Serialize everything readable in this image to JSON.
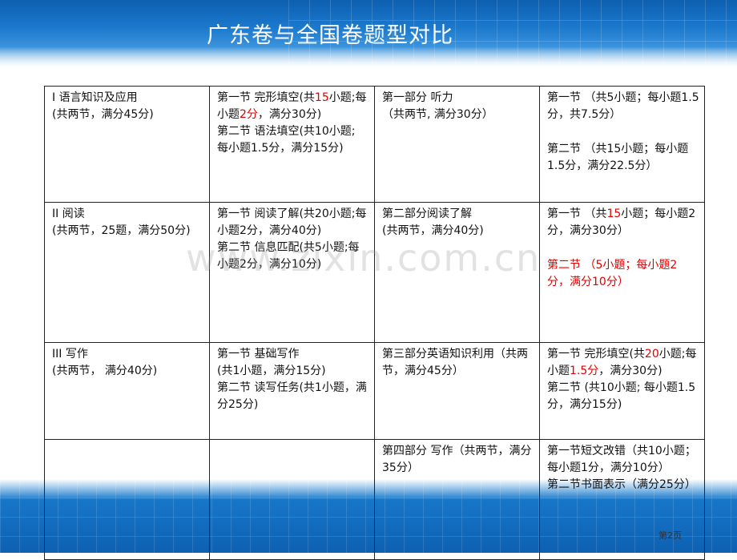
{
  "title": "广东卷与全国卷题型对比",
  "watermark": "www.zixin.com.cn",
  "page_number": "第2页",
  "colors": {
    "accent_red": "#e00000",
    "header_blue": "#1a78cc"
  },
  "rows": [
    {
      "c1": {
        "l1": "I 语言知识及应用",
        "l2": "(共两节，满分45分)"
      },
      "c2": {
        "p1a": "第一节 完形填空(共",
        "p1b": "15",
        "p1c": "小题;每小题",
        "p1d": "2分",
        "p1e": "，满分30分)",
        "p2": "第二节 语法填空(共10小题; 每小题1.5分，满分15分)"
      },
      "c3": {
        "l1": "第一部分 听力",
        "l2": "（共两节, 满分30分）"
      },
      "c4": {
        "l1": "第一节 （共5小题；每小题1.5分，共7.5分）",
        "l2": "第二节 （共15小题；每小题1.5分，满分22.5分）"
      }
    },
    {
      "c1": {
        "l1": "II 阅读",
        "l2": "(共两节，25题，满分50分)"
      },
      "c2": {
        "p1": "第一节 阅读了解(共20小题;每小题2分，满分40分)",
        "p2": "第二节 信息匹配(共5小题;每小题2分，满分10分)"
      },
      "c3": {
        "p1": "第二部分阅读了解",
        "p2": " (共两节，满分40分)"
      },
      "c4": {
        "l1a": "第一节 （共",
        "l1b": "15",
        "l1c": "小题；每小题2分，满分30分）",
        "l2": "第二节 （5小题；每小题2分，满分10分）"
      }
    },
    {
      "c1": {
        "l1": "III 写作",
        "l2": "(共两节， 满分40分)"
      },
      "c2": {
        "l1": "第一节 基础写作",
        "l2": "(共1小题，满分15分)",
        "l3": "第二节 读写任务(共1小题，满分25分)"
      },
      "c3": {
        "p1": "第三部分英语知识利用（共两节，满分45分）"
      },
      "c4": {
        "p1a": "第一节 完形填空(共",
        "p1b": "20",
        "p1c": "小题;每小题",
        "p1d": "1.5分",
        "p1e": "，满分30分)",
        "p2": "第二节 (共10小题; 每小题1.5分，满分15分)"
      }
    },
    {
      "c3": {
        "p1": "第四部分 写作（共两节，满分35分）"
      },
      "c4": {
        "p1": "第一节短文改错（共10小题；每小题1分，满分10分）",
        "p2": "第二节书面表示（满分25分）"
      }
    }
  ]
}
